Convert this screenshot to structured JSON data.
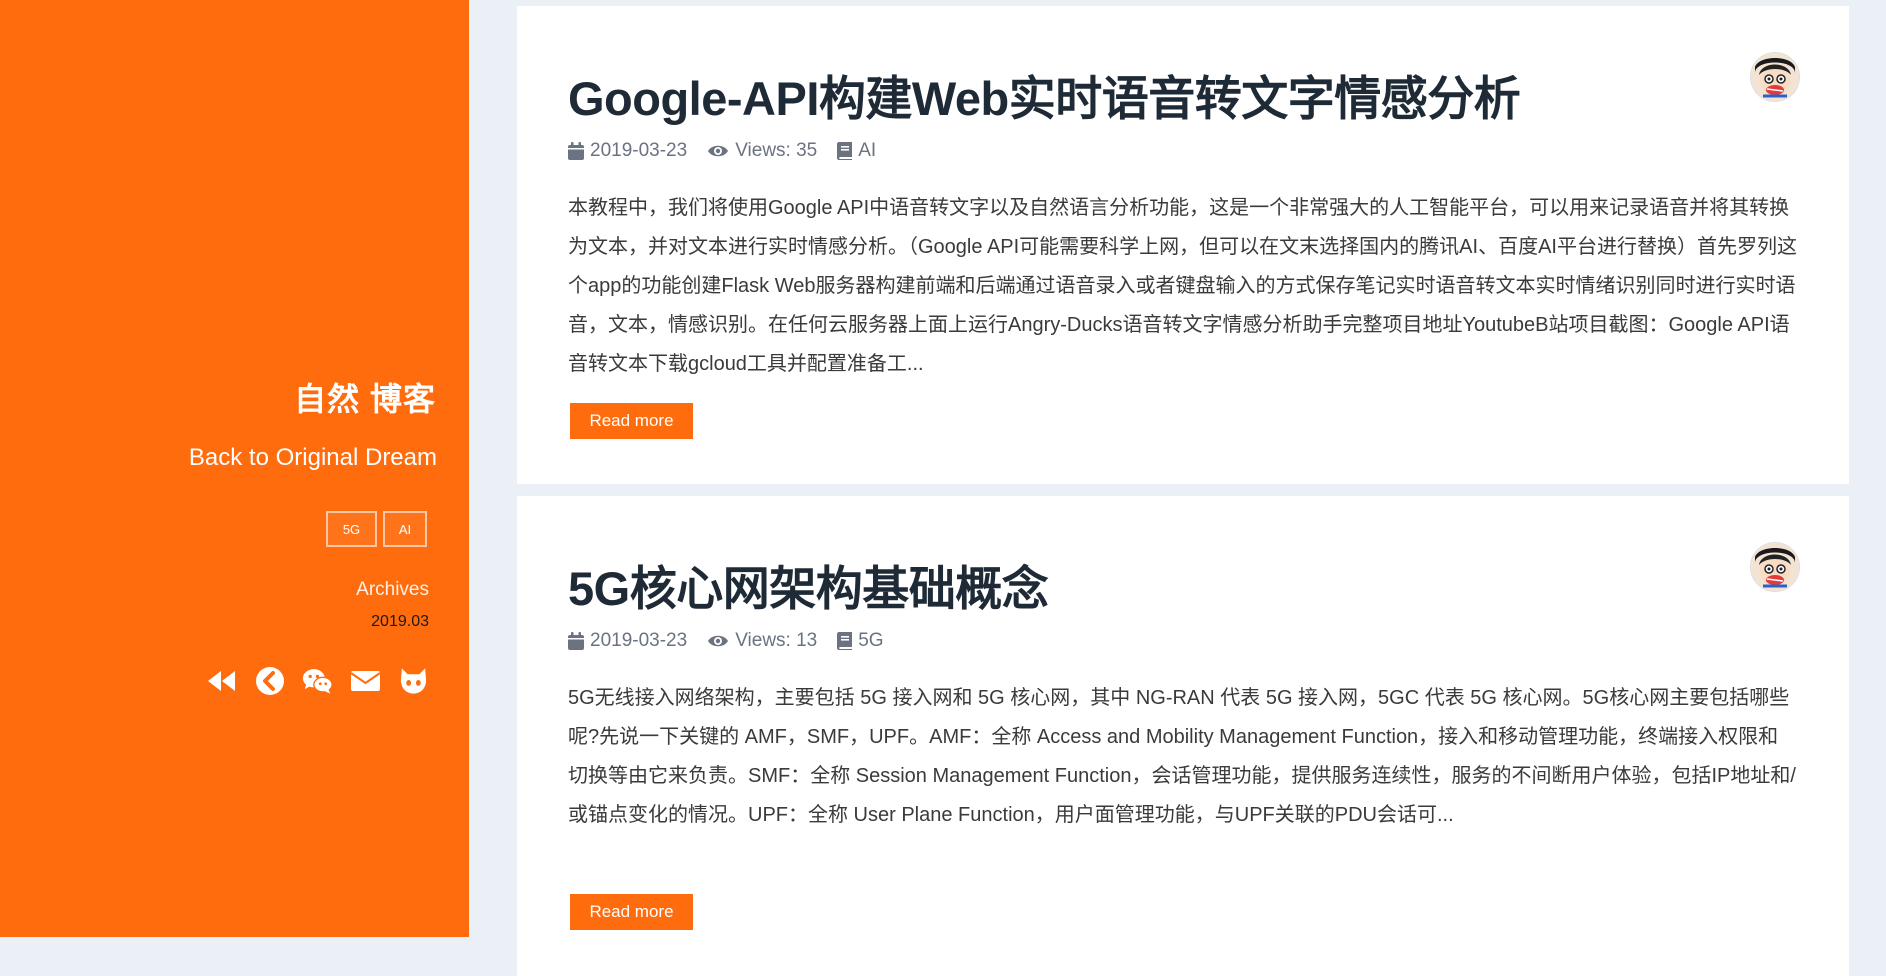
{
  "sidebar": {
    "title": "自然 博客",
    "subtitle": "Back to Original Dream",
    "tags": [
      "5G",
      "AI"
    ],
    "archives_label": "Archives",
    "archives_date": "2019.03",
    "social_icons": [
      "backward-icon",
      "chevron-left-circle-icon",
      "wechat-icon",
      "envelope-icon",
      "github-icon"
    ]
  },
  "posts": [
    {
      "title": "Google-API构建Web实时语音转文字情感分析",
      "date": "2019-03-23",
      "views": "Views: 35",
      "category": "AI",
      "excerpt": "本教程中，我们将使用Google API中语音转文字以及自然语言分析功能，这是一个非常强大的人工智能平台，可以用来记录语音并将其转换为文本，并对文本进行实时情感分析。（Google API可能需要科学上网，但可以在文末选择国内的腾讯AI、百度AI平台进行替换）首先罗列这个app的功能创建Flask Web服务器构建前端和后端通过语音录入或者键盘输入的方式保存笔记实时语音转文本实时情绪识别同时进行实时语音，文本，情感识别。在任何云服务器上面上运行Angry-Ducks语音转文字情感分析助手完整项目地址YoutubeB站项目截图：Google API语音转文本下载gcloud工具并配置准备工...",
      "read_more": "Read more"
    },
    {
      "title": "5G核心网架构基础概念",
      "date": "2019-03-23",
      "views": "Views: 13",
      "category": "5G",
      "excerpt": "5G无线接入网络架构，主要包括 5G 接入网和 5G 核心网，其中 NG-RAN 代表 5G 接入网，5GC 代表 5G 核心网。5G核心网主要包括哪些呢?先说一下关键的 AMF，SMF，UPF。AMF：全称 Access and Mobility Management Function，接入和移动管理功能，终端接入权限和切换等由它来负责。SMF：全称 Session Management Function，会话管理功能，提供服务连续性，服务的不间断用户体验，包括IP地址和/或锚点变化的情况。UPF：全称 User Plane Function，用户面管理功能，与UPF关联的PDU会话可...",
      "read_more": "Read more"
    }
  ],
  "colors": {
    "accent": "#ff6c0d",
    "page_bg": "#eaf0f6",
    "title": "#1f2a37",
    "meta": "#6b7280"
  }
}
